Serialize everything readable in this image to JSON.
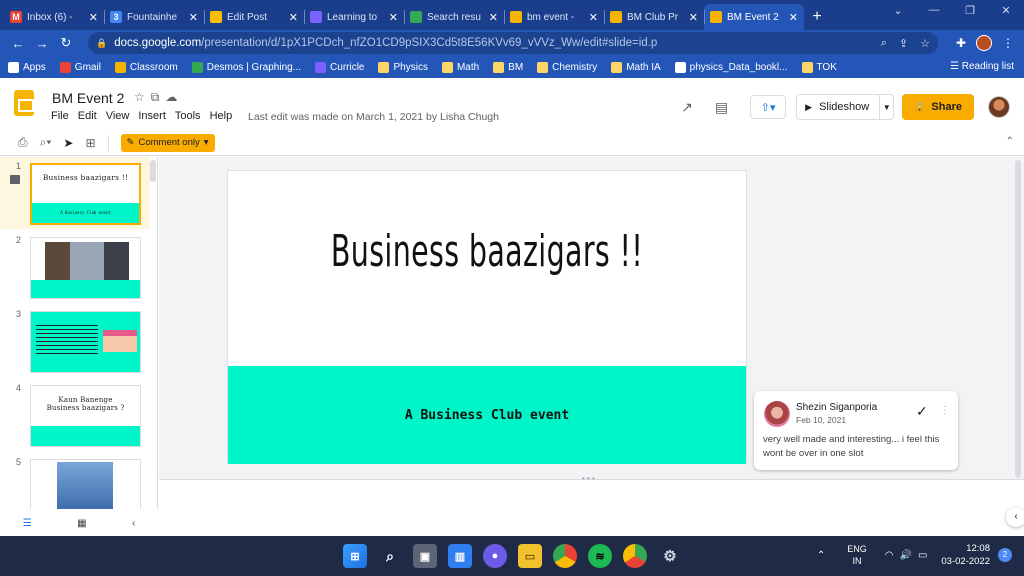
{
  "browser": {
    "tabs": [
      {
        "label": "Inbox (6) - ",
        "icon": "gmail-icon",
        "color": "#ea4335",
        "glyph": "M",
        "active": false
      },
      {
        "label": "Fountainhe",
        "icon": "fountainhead-icon",
        "color": "#4285f4",
        "glyph": "3",
        "active": false
      },
      {
        "label": "Edit Post",
        "icon": "edit-post-icon",
        "color": "#fbbc04",
        "glyph": "",
        "active": false
      },
      {
        "label": "Learning to",
        "icon": "curricle-icon",
        "color": "#7b61ff",
        "glyph": "",
        "active": false
      },
      {
        "label": "Search resu",
        "icon": "drive-icon",
        "color": "#34a853",
        "glyph": "",
        "active": false
      },
      {
        "label": "bm event -",
        "icon": "slides-icon",
        "color": "#f4b400",
        "glyph": "",
        "active": false
      },
      {
        "label": "BM Club Pr",
        "icon": "slides-icon",
        "color": "#f4b400",
        "glyph": "",
        "active": false
      },
      {
        "label": "BM Event 2",
        "icon": "slides-icon",
        "color": "#f4b400",
        "glyph": "",
        "active": true
      }
    ],
    "url_host": "docs.google.com",
    "url_path": "/presentation/d/1pX1PCDch_nfZO1CD9pSIX3Cd5t8E56KVv69_vVVz_Ww/edit#slide=id.p",
    "bookmarks": [
      {
        "label": "Apps",
        "icon": "apps-grid-icon",
        "color": "#ffffff"
      },
      {
        "label": "Gmail",
        "icon": "gmail-icon",
        "color": "#ea4335"
      },
      {
        "label": "Classroom",
        "icon": "classroom-icon",
        "color": "#f4b400"
      },
      {
        "label": "Desmos | Graphing...",
        "icon": "desmos-icon",
        "color": "#34a853"
      },
      {
        "label": "Curricle",
        "icon": "curricle-icon",
        "color": "#7b61ff"
      },
      {
        "label": "Physics",
        "icon": "folder-icon",
        "color": "#fdd663"
      },
      {
        "label": "Math",
        "icon": "folder-icon",
        "color": "#fdd663"
      },
      {
        "label": "BM",
        "icon": "folder-icon",
        "color": "#fdd663"
      },
      {
        "label": "Chemistry",
        "icon": "folder-icon",
        "color": "#fdd663"
      },
      {
        "label": "Math IA",
        "icon": "folder-icon",
        "color": "#fdd663"
      },
      {
        "label": "physics_Data_bookl...",
        "icon": "globe-icon",
        "color": "#ffffff"
      },
      {
        "label": "TOK",
        "icon": "folder-icon",
        "color": "#fdd663"
      }
    ],
    "reading_list": "Reading list"
  },
  "app": {
    "title": "BM Event 2",
    "menu": [
      "File",
      "Edit",
      "View",
      "Insert",
      "Tools",
      "Help"
    ],
    "last_edit": "Last edit was made on March 1, 2021 by Lisha Chugh",
    "slideshow_label": "Slideshow",
    "share_label": "Share",
    "mode_label": "Comment only"
  },
  "filmstrip": [
    {
      "num": "1",
      "title": "Business baazigars !!",
      "sub": "A Business Club event"
    },
    {
      "num": "2",
      "title": "",
      "sub": ""
    },
    {
      "num": "3",
      "title": "",
      "sub": ""
    },
    {
      "num": "4",
      "title": "Kaun Banenge Business baazigars ?",
      "sub": ""
    },
    {
      "num": "5",
      "title": "",
      "sub": ""
    }
  ],
  "slide": {
    "title": "Business baazigars !!",
    "subtitle": "A Business Club event",
    "accent": "#00f5c8"
  },
  "comment": {
    "author": "Shezin Siganporia",
    "date": "Feb 10, 2021",
    "text": "very well made and interesting... i feel this wont be over in one slot"
  },
  "taskbar": {
    "lang1": "ENG",
    "lang2": "IN",
    "time": "12:08",
    "date": "03-02-2022",
    "notifications": "2"
  }
}
